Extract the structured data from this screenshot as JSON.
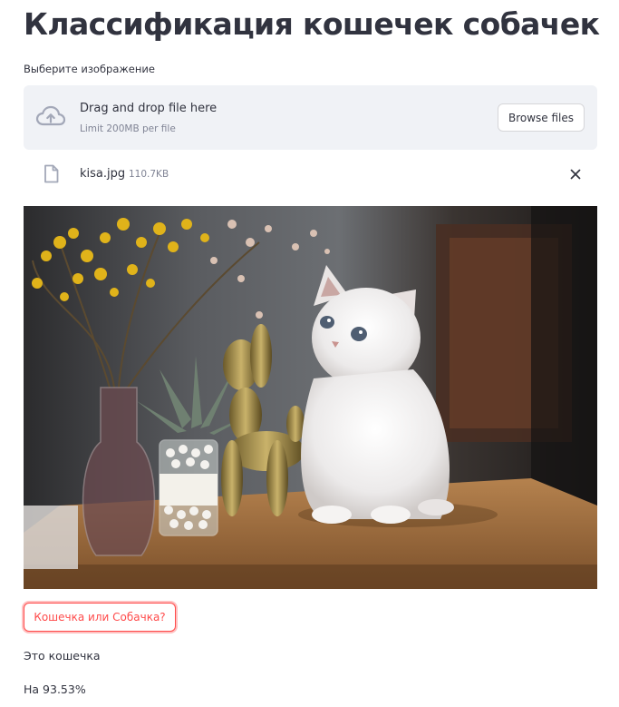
{
  "page": {
    "title": "Классификация кошечек собачек"
  },
  "uploader": {
    "label": "Выберите изображение",
    "drop_title": "Drag and drop file here",
    "limit_text": "Limit 200MB per file",
    "browse_label": "Browse files",
    "icon": "cloud-upload-icon"
  },
  "uploaded_file": {
    "name": "kisa.jpg",
    "size": "110.7KB",
    "file_icon": "file-icon",
    "remove_icon": "close-icon"
  },
  "image": {
    "description_icon": "photo"
  },
  "action": {
    "button_label": "Кошечка или Собачка?"
  },
  "result": {
    "label": "Это кошечка",
    "probability": "На 93.53%"
  },
  "colors": {
    "accent": "#ff4b4b",
    "text": "#31333f",
    "muted": "#808495",
    "dropzone_bg": "#f0f2f6"
  }
}
